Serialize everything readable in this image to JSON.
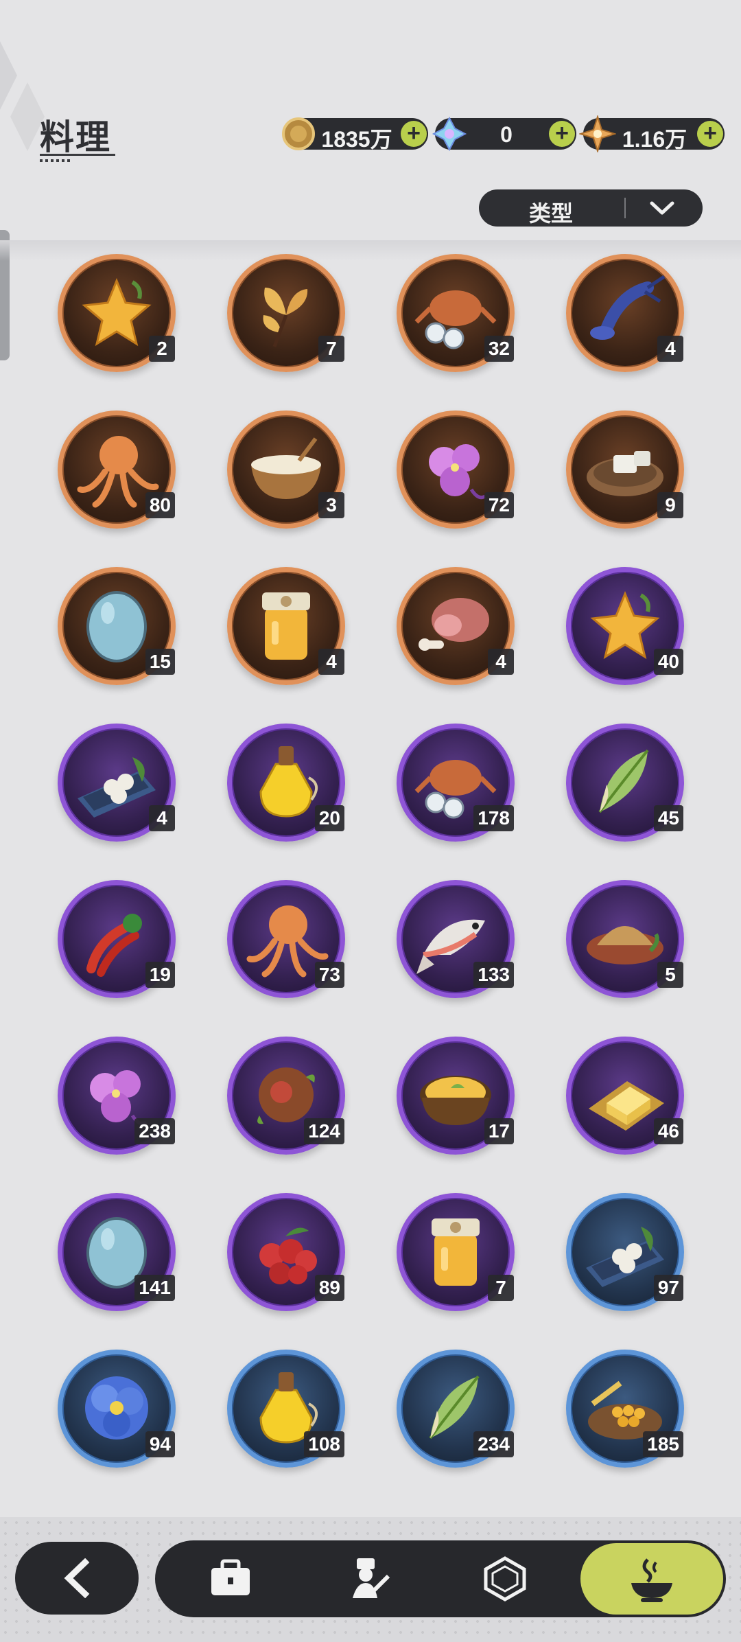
{
  "header": {
    "title": "料理",
    "currencies": [
      {
        "name": "coin-currency",
        "value": "1835万"
      },
      {
        "name": "crystal-currency",
        "value": "0"
      },
      {
        "name": "star-gem-currency",
        "value": "1.16万"
      }
    ],
    "plus_label": "+"
  },
  "filter": {
    "label": "类型"
  },
  "items": [
    {
      "icon": "starfruit-icon",
      "rarity": "orange",
      "count": "2"
    },
    {
      "icon": "ginkgo-leaf-icon",
      "rarity": "orange",
      "count": "7"
    },
    {
      "icon": "crab-icon",
      "rarity": "orange",
      "count": "32"
    },
    {
      "icon": "lobster-icon",
      "rarity": "orange",
      "count": "4"
    },
    {
      "icon": "octopus-icon",
      "rarity": "orange",
      "count": "80"
    },
    {
      "icon": "milk-bowl-icon",
      "rarity": "orange",
      "count": "3"
    },
    {
      "icon": "purple-flower-icon",
      "rarity": "orange",
      "count": "72"
    },
    {
      "icon": "tofu-plate-icon",
      "rarity": "orange",
      "count": "9"
    },
    {
      "icon": "blue-egg-icon",
      "rarity": "orange",
      "count": "15"
    },
    {
      "icon": "honey-jar-icon",
      "rarity": "orange",
      "count": "4"
    },
    {
      "icon": "ham-leg-icon",
      "rarity": "orange",
      "count": "4"
    },
    {
      "icon": "starfruit-icon",
      "rarity": "purple",
      "count": "40"
    },
    {
      "icon": "rice-tray-icon",
      "rarity": "purple",
      "count": "4"
    },
    {
      "icon": "oil-bottle-icon",
      "rarity": "purple",
      "count": "20"
    },
    {
      "icon": "crab-icon",
      "rarity": "purple",
      "count": "178"
    },
    {
      "icon": "bamboo-shoot-icon",
      "rarity": "purple",
      "count": "45"
    },
    {
      "icon": "chili-pepper-icon",
      "rarity": "purple",
      "count": "19"
    },
    {
      "icon": "octopus-icon",
      "rarity": "purple",
      "count": "73"
    },
    {
      "icon": "fish-icon",
      "rarity": "purple",
      "count": "133"
    },
    {
      "icon": "flour-bowl-icon",
      "rarity": "purple",
      "count": "5"
    },
    {
      "icon": "purple-flower-icon",
      "rarity": "purple",
      "count": "238"
    },
    {
      "icon": "chestnut-icon",
      "rarity": "purple",
      "count": "124"
    },
    {
      "icon": "soup-bowl-icon",
      "rarity": "purple",
      "count": "17"
    },
    {
      "icon": "butter-icon",
      "rarity": "purple",
      "count": "46"
    },
    {
      "icon": "blue-egg-icon",
      "rarity": "purple",
      "count": "141"
    },
    {
      "icon": "berries-icon",
      "rarity": "purple",
      "count": "89"
    },
    {
      "icon": "honey-jar-icon",
      "rarity": "purple",
      "count": "7"
    },
    {
      "icon": "rice-tray-icon",
      "rarity": "blue",
      "count": "97"
    },
    {
      "icon": "blue-flower-icon",
      "rarity": "blue",
      "count": "94"
    },
    {
      "icon": "oil-bottle-icon",
      "rarity": "blue",
      "count": "108"
    },
    {
      "icon": "bamboo-shoot-icon",
      "rarity": "blue",
      "count": "234"
    },
    {
      "icon": "corn-basket-icon",
      "rarity": "blue",
      "count": "185"
    }
  ],
  "nav": {
    "tabs": [
      "back-arrow-icon",
      "bag-icon",
      "character-icon",
      "gem-icon",
      "cooking-pot-icon"
    ],
    "active": "cooking-pot-icon",
    "alert": "!"
  },
  "colors": {
    "orange_ring": "#e0915a",
    "purple_ring": "#8e55d6",
    "blue_ring": "#5d95d8",
    "accent": "#c9d35f",
    "dark": "#27282c"
  }
}
